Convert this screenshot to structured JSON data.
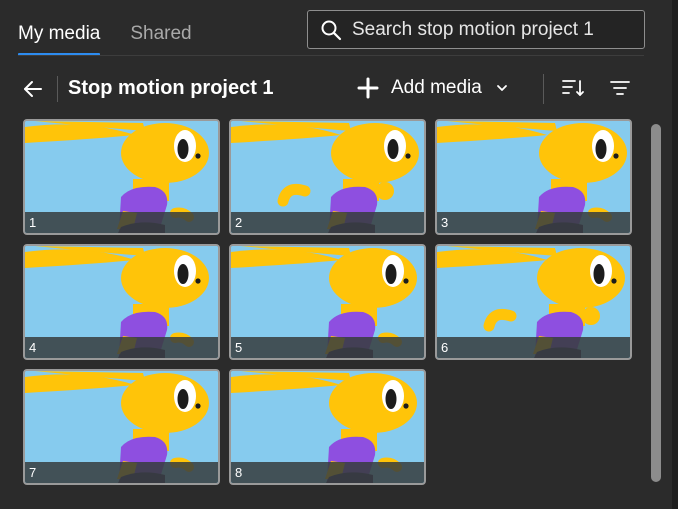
{
  "tabs": [
    {
      "label": "My media",
      "active": true
    },
    {
      "label": "Shared",
      "active": false
    }
  ],
  "search": {
    "placeholder": "Search stop motion project 1",
    "value": ""
  },
  "toolbar": {
    "title": "Stop motion project 1",
    "add_media_label": "Add media",
    "icons": [
      "arrow-left-icon",
      "plus-icon",
      "chevron-down-icon",
      "sort-icon",
      "filter-icon"
    ]
  },
  "media": [
    {
      "label": "1"
    },
    {
      "label": "2"
    },
    {
      "label": "3"
    },
    {
      "label": "4"
    },
    {
      "label": "5"
    },
    {
      "label": "6"
    },
    {
      "label": "7"
    },
    {
      "label": "8"
    }
  ],
  "colors": {
    "accent": "#2d8cf0",
    "background": "#2b2b2b",
    "sky": "#86cbee",
    "rabbit": "#ffc409",
    "shirt": "#8e4fe0"
  }
}
